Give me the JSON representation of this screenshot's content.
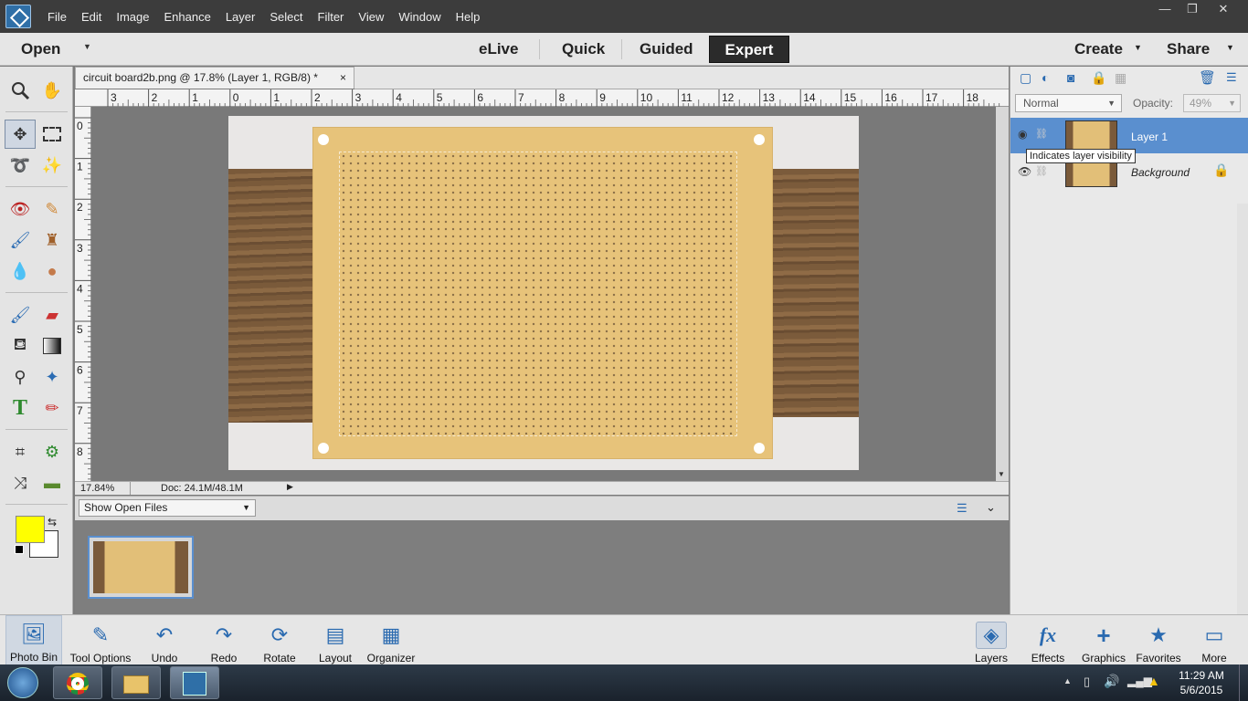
{
  "menu": [
    "File",
    "Edit",
    "Image",
    "Enhance",
    "Layer",
    "Select",
    "Filter",
    "View",
    "Window",
    "Help"
  ],
  "modes": {
    "open": "Open",
    "elive": "eLive",
    "quick": "Quick",
    "guided": "Guided",
    "expert": "Expert",
    "create": "Create",
    "share": "Share"
  },
  "document": {
    "tab_title": "circuit board2b.png @ 17.8% (Layer 1, RGB/8) *",
    "close": "×",
    "zoom": "17.84%",
    "doc_info": "Doc: 24.1M/48.1M"
  },
  "ruler": {
    "h": [
      "3",
      "2",
      "1",
      "0",
      "1",
      "2",
      "3",
      "4",
      "5",
      "6",
      "7",
      "8",
      "9",
      "10",
      "11",
      "12",
      "13",
      "14",
      "15",
      "16",
      "17",
      "18"
    ],
    "v": [
      "0",
      "1",
      "2",
      "3",
      "4",
      "5",
      "6",
      "7",
      "8"
    ]
  },
  "photobin": {
    "dropdown": "Show Open Files"
  },
  "layers_panel": {
    "blend_mode": "Normal",
    "opacity_label": "Opacity:",
    "opacity_value": "49%",
    "layers": [
      {
        "name": "Layer 1",
        "selected": true
      },
      {
        "name": "Background",
        "selected": false
      }
    ],
    "tooltip": "Indicates layer visibility"
  },
  "bottom_left": [
    {
      "label": "Photo Bin",
      "icon": "photo-bin-icon"
    },
    {
      "label": "Tool Options",
      "icon": "tool-options-icon"
    },
    {
      "label": "Undo",
      "icon": "undo-icon"
    },
    {
      "label": "Redo",
      "icon": "redo-icon"
    },
    {
      "label": "Rotate",
      "icon": "rotate-icon"
    },
    {
      "label": "Layout",
      "icon": "layout-icon"
    },
    {
      "label": "Organizer",
      "icon": "organizer-icon"
    }
  ],
  "bottom_right": [
    {
      "label": "Layers",
      "icon": "layers-icon"
    },
    {
      "label": "Effects",
      "icon": "effects-icon"
    },
    {
      "label": "Graphics",
      "icon": "graphics-icon"
    },
    {
      "label": "Favorites",
      "icon": "favorites-icon"
    },
    {
      "label": "More",
      "icon": "more-icon"
    }
  ],
  "taskbar": {
    "time": "11:29 AM",
    "date": "5/6/2015"
  },
  "colors": {
    "foreground": "#ffff00",
    "background": "#ffffff",
    "selection": "#5a8fcf"
  }
}
